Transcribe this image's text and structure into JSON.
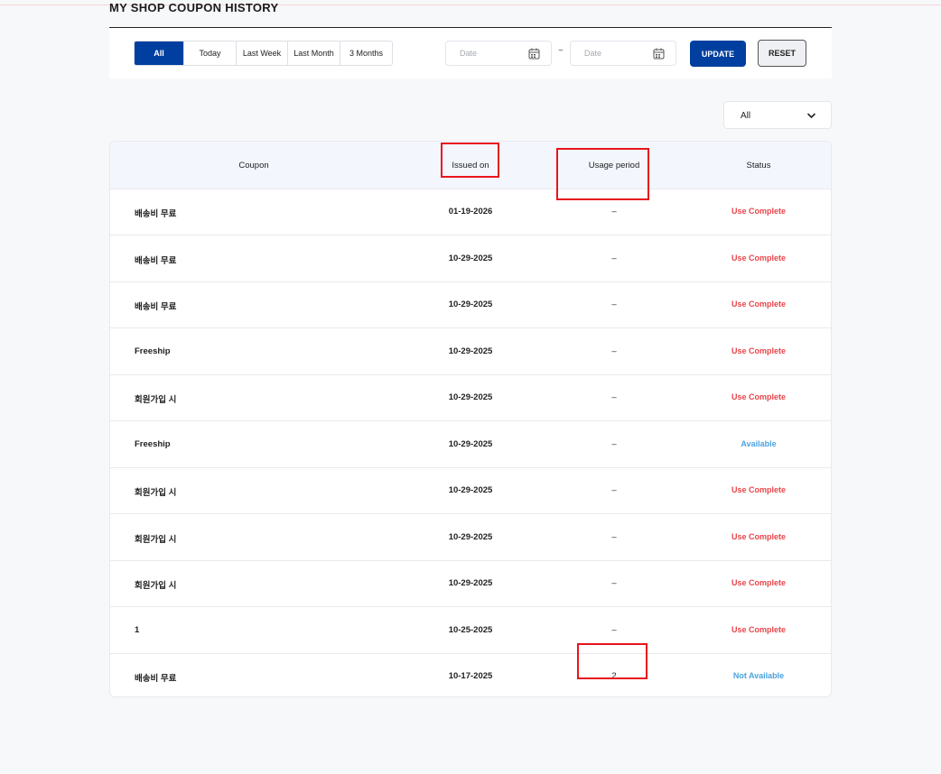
{
  "page": {
    "title": "MY SHOP COUPON HISTORY"
  },
  "filters": {
    "period_tabs": [
      {
        "label": "All",
        "active": true
      },
      {
        "label": "Today",
        "active": false
      },
      {
        "label": "Last Week",
        "active": false
      },
      {
        "label": "Last Month",
        "active": false
      },
      {
        "label": "3 Months",
        "active": false
      }
    ],
    "date_from": {
      "placeholder": "Date",
      "value": ""
    },
    "date_to": {
      "placeholder": "Date",
      "value": ""
    },
    "separator": "~",
    "update_label": "UPDATE",
    "reset_label": "RESET",
    "calendar_icon": "calendar-icon"
  },
  "status_filter": {
    "selected": "All",
    "icon": "chevron-down-icon"
  },
  "table": {
    "columns": [
      "Coupon",
      "Issued on",
      "Usage period",
      "Status"
    ],
    "rows": [
      {
        "coupon": "배송비 무료",
        "issued_on": "01-19-2026",
        "usage_period": "–",
        "status": "Use Complete"
      },
      {
        "coupon": "배송비 무료",
        "issued_on": "10-29-2025",
        "usage_period": "–",
        "status": "Use Complete"
      },
      {
        "coupon": "배송비 무료",
        "issued_on": "10-29-2025",
        "usage_period": "–",
        "status": "Use Complete"
      },
      {
        "coupon": "Freeship",
        "issued_on": "10-29-2025",
        "usage_period": "–",
        "status": "Use Complete"
      },
      {
        "coupon": "회원가입 시",
        "issued_on": "10-29-2025",
        "usage_period": "–",
        "status": "Use Complete"
      },
      {
        "coupon": "Freeship",
        "issued_on": "10-29-2025",
        "usage_period": "–",
        "status": "Available"
      },
      {
        "coupon": "회원가입 시",
        "issued_on": "10-29-2025",
        "usage_period": "–",
        "status": "Use Complete"
      },
      {
        "coupon": "회원가입 시",
        "issued_on": "10-29-2025",
        "usage_period": "–",
        "status": "Use Complete"
      },
      {
        "coupon": "회원가입 시",
        "issued_on": "10-29-2025",
        "usage_period": "–",
        "status": "Use Complete"
      },
      {
        "coupon": "1",
        "issued_on": "10-25-2025",
        "usage_period": "–",
        "status": "Use Complete"
      },
      {
        "coupon": "배송비 무료",
        "issued_on": "10-17-2025",
        "usage_period": "2",
        "status": "Not Available"
      }
    ]
  },
  "colors": {
    "primary": "#003f9f",
    "status_use_complete": "#e8454a",
    "status_available": "#4aa3df",
    "status_not_available": "#4aa3df",
    "highlight_box": "#e8141c",
    "header_bg": "#f3f7fd"
  }
}
